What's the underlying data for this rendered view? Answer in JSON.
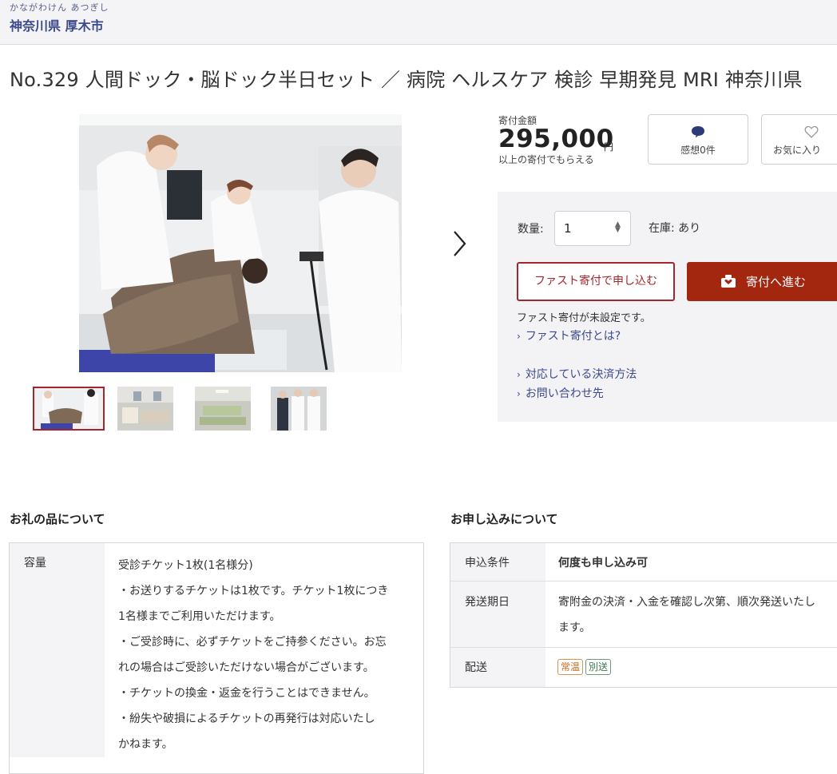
{
  "header": {
    "ruby": "かながわけん あつぎし",
    "municipality": "神奈川県 厚木市"
  },
  "product": {
    "title": "No.329 人間ドック・脳ドック半日セット ／ 病院 ヘルスケア 検診 早期発見 MRI 神奈川県",
    "thumbnails_count": 4,
    "selected_thumbnail": 1
  },
  "price": {
    "label": "寄付金額",
    "amount": "295,000",
    "unit": "円",
    "note": "以上の寄付でもらえる"
  },
  "cards": {
    "reviews": "感想0件",
    "favorite": "お気に入り"
  },
  "order": {
    "quantity_label": "数量:",
    "quantity_value": "1",
    "stock": "在庫: あり",
    "fast_button": "ファスト寄付で申し込む",
    "donate_button": "寄付へ進む",
    "fast_note": "ファスト寄付が未設定です。",
    "links": [
      "ファスト寄付とは?",
      "対応している決済方法",
      "お問い合わせ先"
    ]
  },
  "item_info": {
    "heading": "お礼の品について",
    "label": "容量",
    "lines": [
      "受診チケット1枚(1名様分)",
      "・お送りするチケットは1枚です。チケット1枚につき",
      "1名様までご利用いただけます。",
      "・ご受診時に、必ずチケットをご持参ください。お忘",
      "れの場合はご受診いただけない場合がございます。",
      "・チケットの換金・返金を行うことはできません。",
      "・紛失や破損によるチケットの再発行は対応いたし",
      "かねます。"
    ]
  },
  "application": {
    "heading": "お申し込みについて",
    "rows": [
      {
        "label": "申込条件",
        "value": "何度も申し込み可"
      },
      {
        "label": "発送期日",
        "value": "寄附金の決済・入金を確認し次第、順次発送いたし",
        "value2": "ます。"
      },
      {
        "label": "配送",
        "tags": [
          "常温",
          "別送"
        ]
      }
    ]
  },
  "colors": {
    "accent": "#a3262c",
    "donate": "#a3260f",
    "link": "#3c4a8c"
  }
}
